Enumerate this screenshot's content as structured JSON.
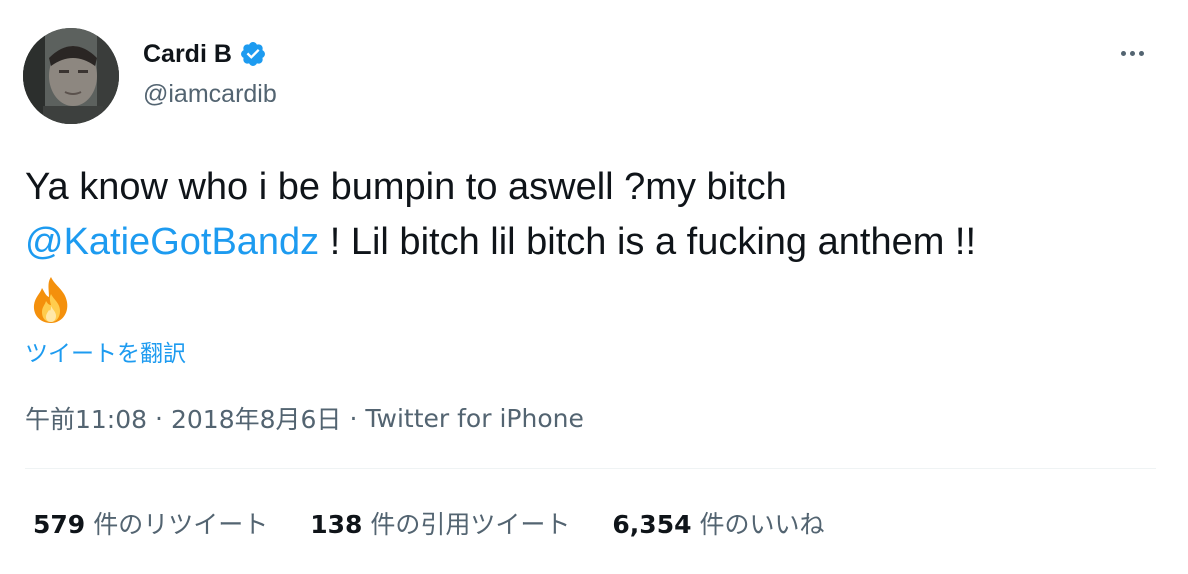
{
  "author": {
    "display_name": "Cardi B",
    "handle": "@iamcardib",
    "verified": true
  },
  "tweet": {
    "text_part1": "Ya know who i be bumpin to aswell ?my bitch",
    "mention": "@KatieGotBandz",
    "text_part2": " ! Lil bitch lil bitch is a fucking anthem !!",
    "emoji": "fire-emoji"
  },
  "translate_label": "ツイートを翻訳",
  "meta": {
    "time": "午前11:08",
    "date": "2018年8月6日",
    "source": "Twitter for iPhone",
    "separator": "·"
  },
  "stats": [
    {
      "count": "579",
      "label": "件のリツイート"
    },
    {
      "count": "138",
      "label": "件の引用ツイート"
    },
    {
      "count": "6,354",
      "label": "件のいいね"
    }
  ],
  "colors": {
    "accent": "#1d9bf0",
    "text": "#0f1419",
    "secondary": "#536471"
  }
}
